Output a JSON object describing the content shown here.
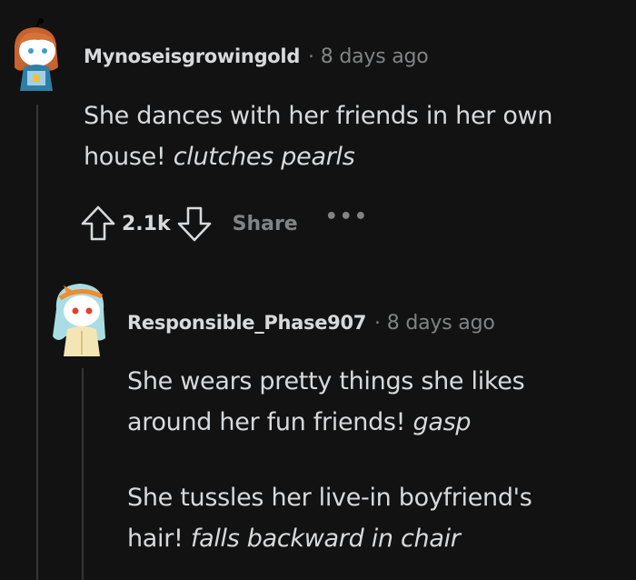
{
  "comment1": {
    "username": "Mynoseisgrowingold",
    "separator": "·",
    "time": "8 days ago",
    "line1": "She dances with her friends in her own",
    "line2_plain": "house! ",
    "line2_italic": "clutches pearls",
    "score": "2.1k",
    "share_label": "Share",
    "more_label": "•••"
  },
  "comment2": {
    "username": "Responsible_Phase907",
    "separator": "·",
    "time": "8 days ago",
    "p1_line1": "She wears pretty things she likes",
    "p1_line2_plain": "around her fun friends! ",
    "p1_line2_italic": "gasp",
    "p2_line1": "She tussles her live-in boyfriend's",
    "p2_line2_plain": "hair! ",
    "p2_line2_italic": "falls backward in chair"
  },
  "icons": {
    "upvote": "upvote-arrow-icon",
    "downvote": "downvote-arrow-icon",
    "avatar1": "snoo-avatar-icon",
    "avatar2": "snoo-avatar-icon"
  },
  "colors": {
    "background": "#121212",
    "text": "#d7dadc",
    "muted": "#818384",
    "thread_line": "#343536"
  }
}
